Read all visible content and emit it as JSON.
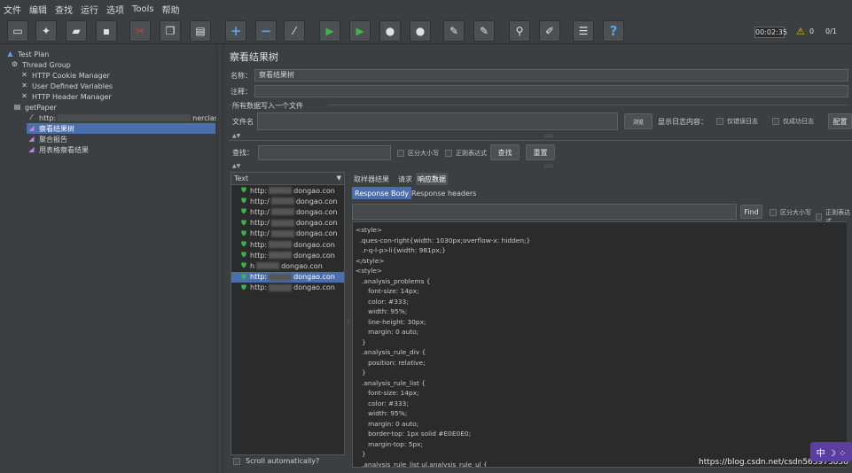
{
  "menu": [
    "文件",
    "编辑",
    "查找",
    "运行",
    "选项",
    "Tools",
    "帮助"
  ],
  "toolbar": {
    "icons": [
      "new-icon",
      "templates-icon",
      "open-icon",
      "save-icon",
      "cut-icon",
      "copy-icon",
      "paste-icon",
      "expand-icon",
      "collapse-icon",
      "toggle-icon",
      "start-icon",
      "start-no-pause-icon",
      "stop-icon",
      "shutdown-icon",
      "clear-icon",
      "clear-all-icon",
      "search-icon",
      "reset-search-icon",
      "function-helper-icon",
      "help-icon"
    ],
    "timer": "00:02:35",
    "warn_count": "0",
    "threads": "0/1"
  },
  "tree": {
    "items": [
      {
        "label": "Test Plan",
        "icon": "test-plan-icon"
      },
      {
        "label": "Thread Group",
        "icon": "thread-group-icon"
      },
      {
        "label": "HTTP Cookie Manager",
        "icon": "config-element-icon"
      },
      {
        "label": "User Defined Variables",
        "icon": "config-element-icon"
      },
      {
        "label": "HTTP Header Manager",
        "icon": "config-element-icon"
      },
      {
        "label": "getPaper",
        "icon": "controller-icon"
      },
      {
        "label": "http:",
        "suffix": "nerclas",
        "icon": "sampler-icon"
      },
      {
        "label": "察看结果树",
        "icon": "listener-icon"
      },
      {
        "label": "聚合报告",
        "icon": "listener-icon"
      },
      {
        "label": "用表格察看结果",
        "icon": "listener-icon"
      }
    ]
  },
  "panel": {
    "title": "察看结果树",
    "name_label": "名称：",
    "name_value": "察看结果树",
    "comment_label": "注释：",
    "file_section": "所有数据写入一个文件",
    "filename_label": "文件名",
    "browse": "浏览",
    "log_label": "显示日志内容：",
    "errors_only": "仅错误日志",
    "success_only": "仅成功日志",
    "configure": "配置",
    "search_label": "查找：",
    "case_sensitive": "区分大小写",
    "regex": "正则表达式",
    "search_button": "查找",
    "reset_button": "重置"
  },
  "results": {
    "header": "Text",
    "rows": [
      {
        "prefix": "http:",
        "suffix": "dongao.con"
      },
      {
        "prefix": "http:/",
        "suffix": "dongao.con"
      },
      {
        "prefix": "http:/",
        "suffix": "dongao.con"
      },
      {
        "prefix": "http:/",
        "suffix": "dongao.con"
      },
      {
        "prefix": "http:/",
        "suffix": "dongao.con"
      },
      {
        "prefix": "http:",
        "suffix": "dongao.con"
      },
      {
        "prefix": "http:",
        "suffix": "dongao.con"
      },
      {
        "prefix": "h",
        "suffix": "dongao.con"
      },
      {
        "prefix": "http:",
        "suffix": "dongao.con"
      },
      {
        "prefix": "http:",
        "suffix": "dongao.con"
      }
    ],
    "selected_index": 8,
    "autoscroll": "Scroll automatically?"
  },
  "detail": {
    "tabs": [
      "取样器结果",
      "请求",
      "响应数据"
    ],
    "active_tab": 2,
    "subtabs": [
      "Response Body",
      "Response headers"
    ],
    "find_button": "Find",
    "case_sensitive": "区分大小写",
    "regex": "正则表达式",
    "code_lines": [
      "<style>",
      "  .ques-con-right{width: 1030px;overflow-x: hidden;}",
      "   .r-q-l-p>li{width: 981px;}",
      "</style>",
      "<style>",
      "   .analysis_problems {",
      "      font-size: 14px;",
      "      color: #333;",
      "      width: 95%;",
      "      line-height: 30px;",
      "      margin: 0 auto;",
      "   }",
      "   .analysis_rule_div {",
      "      position: relative;",
      "   }",
      "   .analysis_rule_list {",
      "      font-size: 14px;",
      "      color: #333;",
      "      width: 95%;",
      "      margin: 0 auto;",
      "      border-top: 1px solid #E0E0E0;",
      "      margin-top: 5px;",
      "   }",
      "   .analysis_rule_list ul.analysis_rule_ul {"
    ]
  },
  "watermark": "https://blog.csdn.net/csdn565973850",
  "badge": "中 ☽ ⁘"
}
